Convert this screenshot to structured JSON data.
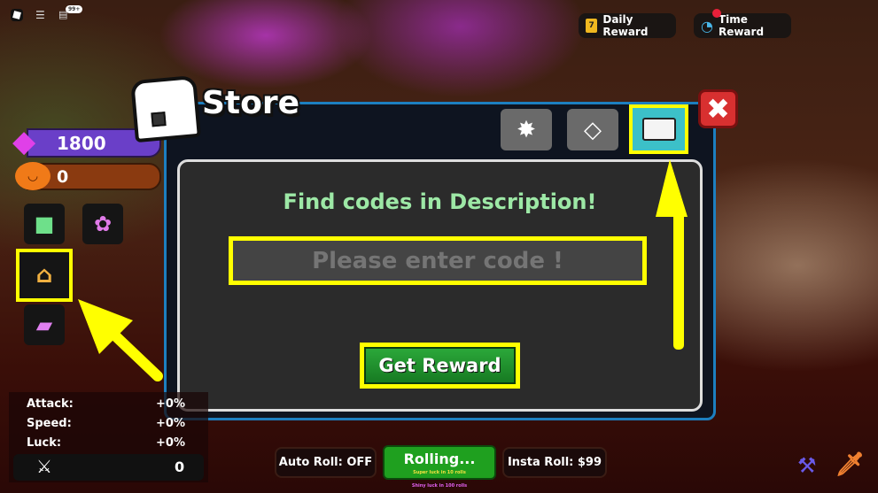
{
  "topbar": {
    "notif_badge": "99+"
  },
  "rewards": {
    "daily": "Daily Reward",
    "daily_day": "7",
    "time": "Time Reward"
  },
  "currency": {
    "gems": "1800",
    "pumpkins": "0"
  },
  "store": {
    "title": "Store",
    "heading": "Find codes in Description!",
    "code_placeholder": "Please enter code !",
    "submit": "Get Reward",
    "tabs": [
      "gear-icon",
      "diamond-icon",
      "ticket-icon"
    ],
    "active_tab": "ticket-icon"
  },
  "stats": {
    "attack_label": "Attack:",
    "attack_value": "+0%",
    "speed_label": "Speed:",
    "speed_value": "+0%",
    "luck_label": "Luck:",
    "luck_value": "+0%",
    "power_value": "0"
  },
  "roll": {
    "auto": "Auto Roll: OFF",
    "rolling": "Rolling...",
    "super_luck": "Super luck in 10 rolls",
    "shiny_luck": "Shiny luck in 100 rolls",
    "insta": "Insta Roll: $99"
  },
  "colors": {
    "highlight": "#ffff00",
    "heading": "#9de8a6",
    "close": "#d83030",
    "tab_active": "#3cc0c8",
    "gem_bar": "#6a3fc8",
    "pumpkin_bar": "#8a3a10",
    "roll_green": "#1fa01f"
  }
}
